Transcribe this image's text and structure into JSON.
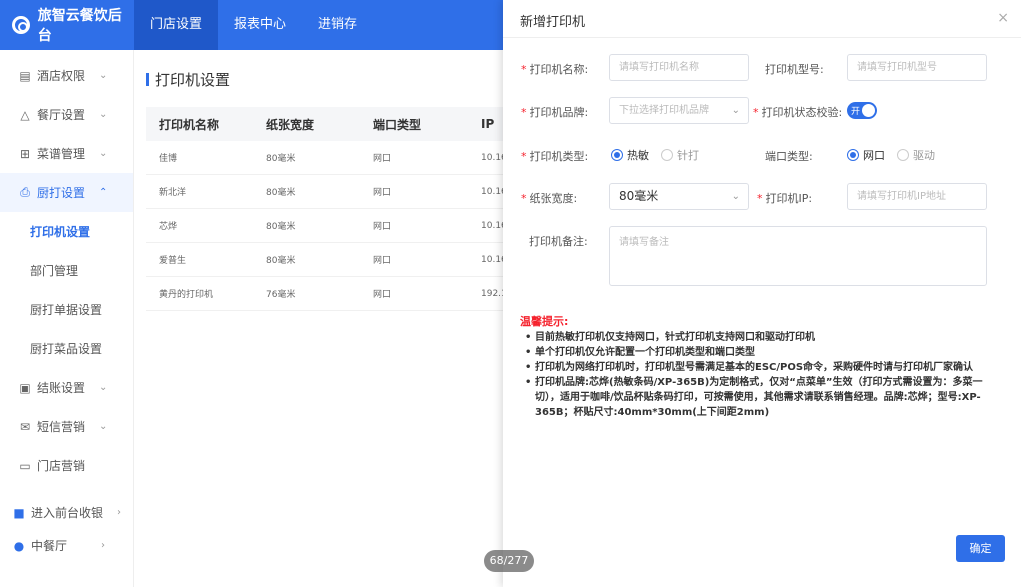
{
  "brand": {
    "name": "旅智云餐饮后台"
  },
  "topnav": [
    {
      "label": "门店设置"
    },
    {
      "label": "报表中心"
    },
    {
      "label": "进销存"
    }
  ],
  "sidebar": {
    "items": [
      {
        "icon": "hotel-permission-icon",
        "label": "酒店权限"
      },
      {
        "icon": "restaurant-settings-icon",
        "label": "餐厅设置"
      },
      {
        "icon": "menu-grid-icon",
        "label": "菜谱管理"
      },
      {
        "icon": "kitchen-print-icon",
        "label": "厨打设置"
      }
    ],
    "subitems": [
      {
        "label": "打印机设置"
      },
      {
        "label": "部门管理"
      },
      {
        "label": "厨打单据设置"
      },
      {
        "label": "厨打菜品设置"
      }
    ],
    "items2": [
      {
        "icon": "checkout-icon",
        "label": "结账设置"
      },
      {
        "icon": "sms-icon",
        "label": "短信营销"
      },
      {
        "icon": "store-marketing-icon",
        "label": "门店营销"
      }
    ],
    "bottom": [
      {
        "label": "进入前台收银"
      },
      {
        "label": "中餐厅"
      }
    ]
  },
  "page": {
    "title": "打印机设置"
  },
  "table": {
    "headers": [
      "打印机名称",
      "纸张宽度",
      "端口类型",
      "IP"
    ],
    "rows": [
      [
        "佳博",
        "80毫米",
        "网口",
        "10.16"
      ],
      [
        "新北洋",
        "80毫米",
        "网口",
        "10.16"
      ],
      [
        "芯烨",
        "80毫米",
        "网口",
        "10.16"
      ],
      [
        "爱普生",
        "80毫米",
        "网口",
        "10.16"
      ],
      [
        "黄丹的打印机",
        "76毫米",
        "网口",
        "192.1"
      ]
    ]
  },
  "drawer": {
    "title": "新增打印机",
    "close": "×",
    "fields": {
      "printer_name_label": "打印机名称:",
      "printer_name_placeholder": "请填写打印机名称",
      "printer_model_label": "打印机型号:",
      "printer_model_placeholder": "请填写打印机型号",
      "printer_brand_label": "打印机品牌:",
      "printer_brand_placeholder": "下拉选择打印机品牌",
      "status_check_label": "打印机状态校验:",
      "status_check_switch": "开",
      "printer_type_label": "打印机类型:",
      "printer_type_options": [
        "热敏",
        "针打"
      ],
      "port_type_label": "端口类型:",
      "port_type_options": [
        "网口",
        "驱动"
      ],
      "paper_width_label": "纸张宽度:",
      "paper_width_value": "80毫米",
      "printer_ip_label": "打印机IP:",
      "printer_ip_placeholder": "请填写打印机IP地址",
      "remark_label": "打印机备注:",
      "remark_placeholder": "请填写备注"
    },
    "tips_title": "温馨提示:",
    "tips": [
      "目前热敏打印机仅支持网口，针式打印机支持网口和驱动打印机",
      "单个打印机仅允许配置一个打印机类型和端口类型",
      "打印机为网络打印机时，打印机型号需满足基本的ESC/POS命令，采购硬件时请与打印机厂家确认",
      "打印机品牌:芯烨(热敏条码/XP-365B)为定制格式，仅对“点菜单”生效（打印方式需设置为：多菜一切），适用于咖啡/饮品杯贴条码打印，可按需使用，其他需求请联系销售经理。品牌:芯烨；型号:XP-365B；杯贴尺寸:40mm*30mm(上下间距2mm)"
    ],
    "confirm": "确定"
  },
  "pager": {
    "text": "68/277"
  }
}
